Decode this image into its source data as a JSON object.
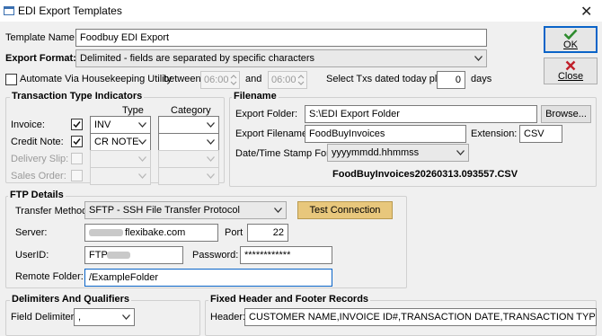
{
  "window": {
    "title": "EDI Export Templates",
    "close_glyph": "✕"
  },
  "template": {
    "name_label": "Template Name:",
    "name_value": "Foodbuy EDI Export"
  },
  "export_format": {
    "label": "Export Format:",
    "value": "Delimited - fields are separated by specific characters"
  },
  "automate": {
    "label": "Automate Via Housekeeping Utility",
    "between_label": "between",
    "time_start": "06:00",
    "and_label": "and",
    "time_end": "06:00",
    "txs_label": "Select Txs dated today plus",
    "days_value": "0",
    "days_label": "days"
  },
  "actions": {
    "ok_label": "OK",
    "close_label": "Close",
    "ok_icon": "checkmark-icon",
    "close_icon": "x-icon"
  },
  "transaction_types": {
    "title": "Transaction Type Indicators",
    "type_header": "Type",
    "category_header": "Category",
    "rows": [
      {
        "label": "Invoice:",
        "checked": true,
        "enabled": true,
        "type": "INV",
        "category": ""
      },
      {
        "label": "Credit Note:",
        "checked": true,
        "enabled": true,
        "type": "CR NOTE",
        "category": ""
      },
      {
        "label": "Delivery Slip:",
        "checked": false,
        "enabled": false,
        "type": "",
        "category": ""
      },
      {
        "label": "Sales Order:",
        "checked": false,
        "enabled": false,
        "type": "",
        "category": ""
      }
    ]
  },
  "filename": {
    "title": "Filename",
    "folder_label": "Export Folder:",
    "folder_value": "S:\\EDI Export Folder",
    "browse_label": "Browse...",
    "file_label": "Export Filename:",
    "file_value": "FoodBuyInvoices",
    "ext_label": "Extension:",
    "ext_value": "CSV",
    "stamp_label": "Date/Time Stamp Format:",
    "stamp_value": "yyyymmdd.hhmmss",
    "preview": "FoodBuyInvoices20260313.093557.CSV"
  },
  "ftp": {
    "title": "FTP Details",
    "method_label": "Transfer Method:",
    "method_value": "SFTP - SSH File Transfer Protocol",
    "test_label": "Test Connection",
    "server_label": "Server:",
    "server_value": "flexibake.com",
    "port_label": "Port",
    "port_value": "22",
    "userid_label": "UserID:",
    "userid_value": "FTP",
    "password_label": "Password:",
    "password_value": "************",
    "remote_label": "Remote Folder:",
    "remote_value": "/ExampleFolder"
  },
  "delimiters": {
    "title": "Delimiters And Qualifiers",
    "field_label": "Field Delimiter:",
    "field_value": ","
  },
  "header_footer": {
    "title": "Fixed Header and Footer Records",
    "header_label": "Header:",
    "header_value": "CUSTOMER NAME,INVOICE ID#,TRANSACTION DATE,TRANSACTION TYPE,LINE"
  },
  "colors": {
    "accent": "#0a64c8",
    "test_button": "#e8c77c",
    "ok_check": "#2e8b2e",
    "close_x": "#c0202a"
  }
}
